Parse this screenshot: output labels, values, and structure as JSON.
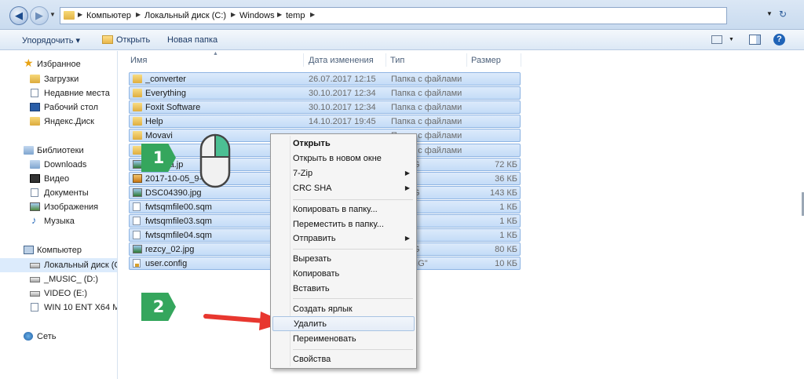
{
  "address": {
    "segments": [
      "Компьютер",
      "Локальный диск (C:)",
      "Windows",
      "temp"
    ]
  },
  "toolbar": {
    "organize": "Упорядочить ▾",
    "open": "Открыть",
    "new_folder": "Новая папка",
    "help": "?"
  },
  "nav": {
    "favorites": "Избранное",
    "downloads": "Загрузки",
    "recent": "Недавние места",
    "desktop": "Рабочий стол",
    "yandex": "Яндекс.Диск",
    "libraries": "Библиотеки",
    "lib_downloads": "Downloads",
    "video": "Видео",
    "documents": "Документы",
    "images": "Изображения",
    "music": "Музыка",
    "computer": "Компьютер",
    "local_disk": "Локальный диск (C",
    "music_drive": "_MUSIC_ (D:)",
    "video_drive": "VIDEO (E:)",
    "win_drive": "WIN 10 ENT X64 ML",
    "network": "Сеть"
  },
  "columns": {
    "name": "Имя",
    "date": "Дата изменения",
    "type": "Тип",
    "size": "Размер"
  },
  "files": [
    {
      "icon": "folder",
      "name": "_converter",
      "date": "26.07.2017 12:15",
      "type": "Папка с файлами",
      "size": ""
    },
    {
      "icon": "folder",
      "name": "Everything",
      "date": "30.10.2017 12:34",
      "type": "Папка с файлами",
      "size": ""
    },
    {
      "icon": "folder",
      "name": "Foxit Software",
      "date": "30.10.2017 12:34",
      "type": "Папка с файлами",
      "size": ""
    },
    {
      "icon": "folder",
      "name": "Help",
      "date": "14.10.2017 19:45",
      "type": "Папка с файлами",
      "size": ""
    },
    {
      "icon": "folder",
      "name": "Movavi",
      "date": "",
      "type": "Папка с файлами",
      "size": ""
    },
    {
      "icon": "folder",
      "name": "nc",
      "date": "",
      "type": "Папка с файлами",
      "size": ""
    },
    {
      "icon": "jpg",
      "name": "1475ea.jp",
      "date": "",
      "type": "к JPEG",
      "size": "72 КБ"
    },
    {
      "icon": "png",
      "name": "2017-10-05_9-1",
      "date": "",
      "type": "к PNG",
      "size": "36 КБ"
    },
    {
      "icon": "jpg",
      "name": "DSC04390.jpg",
      "date": "",
      "type": "к JPEG",
      "size": "143 КБ"
    },
    {
      "icon": "file",
      "name": "fwtsqmfile00.sqm",
      "date": "",
      "type": "SQM\"",
      "size": "1 КБ"
    },
    {
      "icon": "file",
      "name": "fwtsqmfile03.sqm",
      "date": "",
      "type": "SQM\"",
      "size": "1 КБ"
    },
    {
      "icon": "file",
      "name": "fwtsqmfile04.sqm",
      "date": "",
      "type": "SQM\"",
      "size": "1 КБ"
    },
    {
      "icon": "jpg",
      "name": "rezcy_02.jpg",
      "date": "",
      "type": "к JPEG",
      "size": "80 КБ"
    },
    {
      "icon": "config",
      "name": "user.config",
      "date": "",
      "type": "CONFIG\"",
      "size": "10 КБ"
    }
  ],
  "context_menu": {
    "open": "Открыть",
    "open_new_window": "Открыть в новом окне",
    "zip": "7-Zip",
    "crc": "CRC SHA",
    "copy_to": "Копировать в папку...",
    "move_to": "Переместить в папку...",
    "send_to": "Отправить",
    "cut": "Вырезать",
    "copy": "Копировать",
    "paste": "Вставить",
    "shortcut": "Создать ярлык",
    "delete": "Удалить",
    "rename": "Переименовать",
    "properties": "Свойства"
  },
  "badges": {
    "step1": "1",
    "step2": "2"
  },
  "colors": {
    "selection": "#c4dcf7",
    "badge": "#35a65d",
    "arrow": "#e8372f"
  }
}
